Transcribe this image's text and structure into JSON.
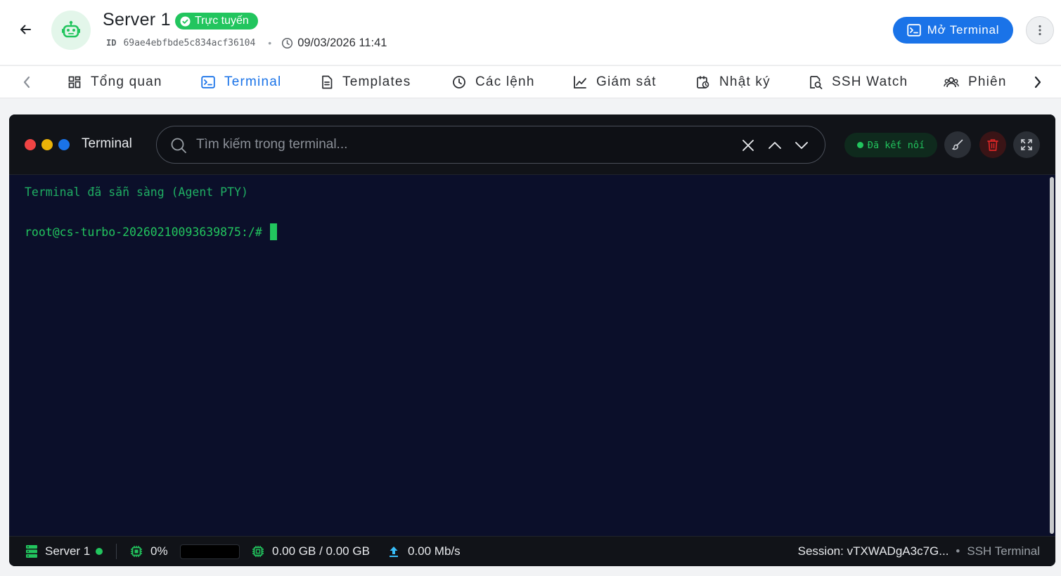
{
  "header": {
    "title": "Server 1",
    "status": "Trực tuyến",
    "id_label": "ID",
    "id_value": "69ae4ebfbde5c834acf36104",
    "timestamp": "09/03/2026 11:41",
    "open_terminal_label": "Mở Terminal"
  },
  "tabs": [
    {
      "label": "Tổng quan",
      "icon": "grid-icon"
    },
    {
      "label": "Terminal",
      "icon": "terminal-icon",
      "active": true
    },
    {
      "label": "Templates",
      "icon": "document-icon"
    },
    {
      "label": "Các lệnh",
      "icon": "clock-icon"
    },
    {
      "label": "Giám sát",
      "icon": "chart-line-icon"
    },
    {
      "label": "Nhật ký",
      "icon": "log-icon"
    },
    {
      "label": "SSH Watch",
      "icon": "ssh-watch-icon"
    },
    {
      "label": "Phiên",
      "icon": "users-icon"
    }
  ],
  "terminal": {
    "title": "Terminal",
    "search_placeholder": "Tìm kiếm trong terminal...",
    "connection_status": "Đã kết nối",
    "lines": [
      "Terminal đã sẵn sàng (Agent PTY)",
      "root@cs-turbo-20260210093639875:/#"
    ]
  },
  "status_bar": {
    "server_name": "Server 1",
    "cpu_percent": "0%",
    "cpu_fraction": 0,
    "memory": "0.00 GB / 0.00 GB",
    "network": "0.00 Mb/s",
    "session": "Session: vTXWADgA3c7G...",
    "session_type": "SSH Terminal"
  },
  "colors": {
    "accent": "#1a73e8",
    "online": "#22c55e",
    "terminal_bg": "#0b0f2a",
    "danger": "#dc2626"
  }
}
